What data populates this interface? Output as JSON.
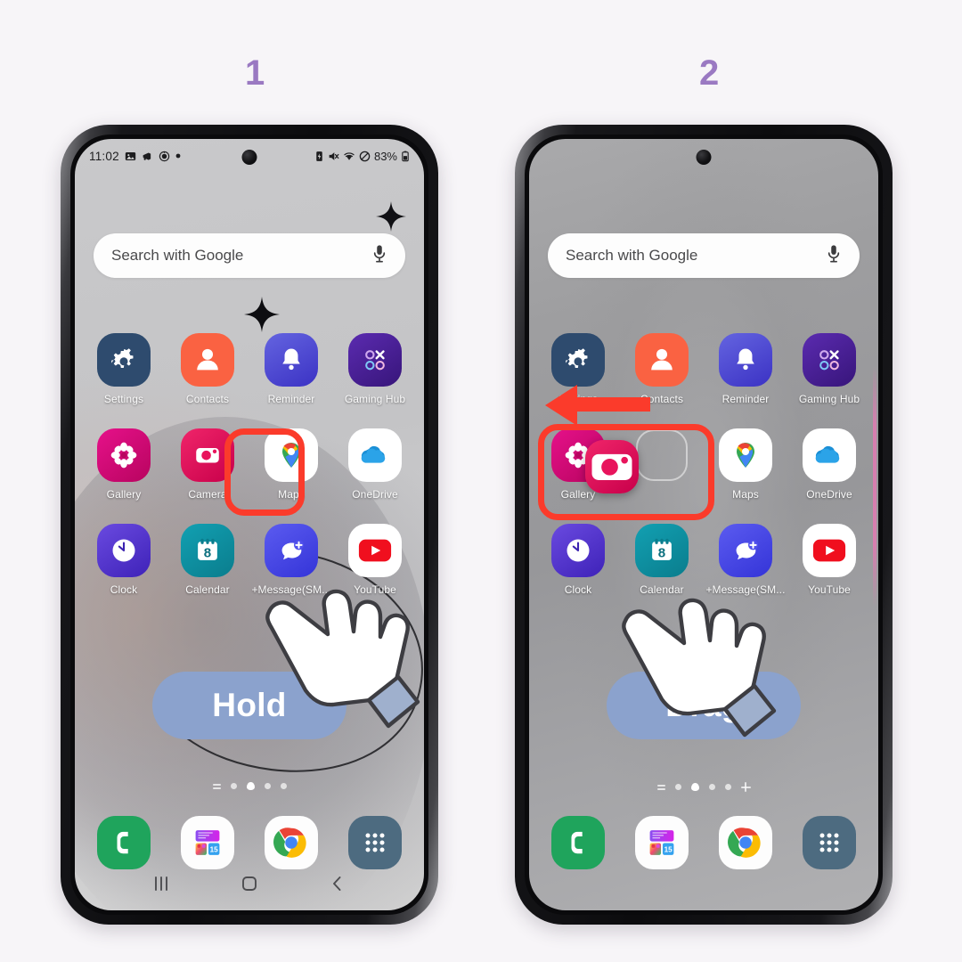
{
  "page": {
    "background_color": "#f7f5f8",
    "accent_color": "#9a79c2",
    "highlight_color": "#fb3b2b",
    "pill_color": "#8ba2cd"
  },
  "steps": [
    {
      "number": "1",
      "hint_label": "Hold"
    },
    {
      "number": "2",
      "hint_label": "Drag"
    }
  ],
  "phone1": {
    "status_bar": {
      "clock": "11:02",
      "battery_percent": "83%",
      "left_icons": [
        "gallery-icon",
        "megaphone-icon",
        "smartface-icon",
        "dot-icon"
      ],
      "right_icons": [
        "power-saving-icon",
        "mute-icon",
        "wifi-icon",
        "dnd-icon",
        "battery-icon"
      ]
    },
    "search": {
      "placeholder": "Search with Google",
      "mic_icon": "microphone-icon"
    },
    "apps": [
      {
        "label": "Settings",
        "icon": "settings-gear-icon",
        "color": "#2e4b6e"
      },
      {
        "label": "Contacts",
        "icon": "contacts-person-icon",
        "color": "#fa6242"
      },
      {
        "label": "Reminder",
        "icon": "bell-icon",
        "color": "#4747cf"
      },
      {
        "label": "Gaming Hub",
        "icon": "gaming-hub-icon",
        "color": "#4a2396"
      },
      {
        "label": "Gallery",
        "icon": "gallery-flower-icon",
        "color": "#d4097b"
      },
      {
        "label": "Camera",
        "icon": "camera-icon",
        "color": "#e01355"
      },
      {
        "label": "Maps",
        "icon": "google-maps-icon",
        "color": "#ffffff"
      },
      {
        "label": "OneDrive",
        "icon": "onedrive-cloud-icon",
        "color": "#ffffff"
      },
      {
        "label": "Clock",
        "icon": "clock-icon",
        "color": "#4b31c7"
      },
      {
        "label": "Calendar",
        "icon": "calendar-icon",
        "color": "#0e8c9b"
      },
      {
        "label": "+Message(SM...",
        "icon": "plus-message-icon",
        "color": "#4242e8"
      },
      {
        "label": "YouTube",
        "icon": "youtube-icon",
        "color": "#ffffff"
      }
    ],
    "calendar_day": "8",
    "dock": [
      {
        "label": "Phone",
        "icon": "phone-handset-icon",
        "color": "#1fa45c"
      },
      {
        "label": "Widgets",
        "icon": "samsung-widget-icon",
        "color": "#ffffff"
      },
      {
        "label": "Chrome",
        "icon": "chrome-icon",
        "color": "#ffffff"
      },
      {
        "label": "Apps",
        "icon": "app-drawer-icon",
        "color": "#4d6b80"
      }
    ],
    "dock_calendar_day": "15",
    "page_indicator": {
      "count": 5,
      "active_index": 2,
      "leading": "widgets-icon",
      "trailing": ""
    },
    "nav_bar": [
      "recents-icon",
      "home-icon",
      "back-icon"
    ],
    "highlighted_app": "Camera",
    "hint_label": "Hold"
  },
  "phone2": {
    "status_bar": {
      "clock": "",
      "battery_percent": ""
    },
    "search": {
      "placeholder": "Search with Google",
      "mic_icon": "microphone-icon"
    },
    "apps": [
      {
        "label": "Settings",
        "icon": "settings-gear-icon",
        "color": "#2e4b6e"
      },
      {
        "label": "Contacts",
        "icon": "contacts-person-icon",
        "color": "#fa6242"
      },
      {
        "label": "Reminder",
        "icon": "bell-icon",
        "color": "#4747cf"
      },
      {
        "label": "Gaming Hub",
        "icon": "gaming-hub-icon",
        "color": "#4a2396"
      },
      {
        "label": "Gallery",
        "icon": "gallery-flower-icon",
        "color": "#d4097b"
      },
      {
        "label": "",
        "icon": "empty-slot",
        "color": "transparent"
      },
      {
        "label": "Maps",
        "icon": "google-maps-icon",
        "color": "#ffffff"
      },
      {
        "label": "OneDrive",
        "icon": "onedrive-cloud-icon",
        "color": "#ffffff"
      },
      {
        "label": "Clock",
        "icon": "clock-icon",
        "color": "#4b31c7"
      },
      {
        "label": "Calendar",
        "icon": "calendar-icon",
        "color": "#0e8c9b"
      },
      {
        "label": "+Message(SM...",
        "icon": "plus-message-icon",
        "color": "#4242e8"
      },
      {
        "label": "YouTube",
        "icon": "youtube-icon",
        "color": "#ffffff"
      }
    ],
    "calendar_day": "8",
    "dragged_app": {
      "label": "Camera",
      "icon": "camera-icon",
      "color": "#e01355"
    },
    "dock": [
      {
        "label": "Phone",
        "icon": "phone-handset-icon",
        "color": "#1fa45c"
      },
      {
        "label": "Widgets",
        "icon": "samsung-widget-icon",
        "color": "#ffffff"
      },
      {
        "label": "Chrome",
        "icon": "chrome-icon",
        "color": "#ffffff"
      },
      {
        "label": "Apps",
        "icon": "app-drawer-icon",
        "color": "#4d6b80"
      }
    ],
    "dock_calendar_day": "15",
    "page_indicator": {
      "count": 5,
      "active_index": 2,
      "leading": "widgets-icon",
      "trailing": "plus-icon"
    },
    "nav_bar": [],
    "highlighted_app": "Gallery",
    "arrow_direction": "left",
    "hint_label": "Drag"
  }
}
